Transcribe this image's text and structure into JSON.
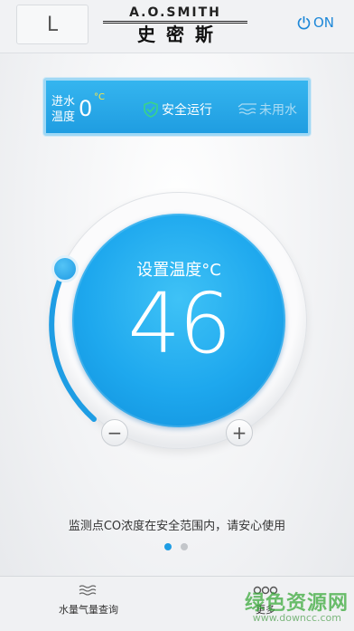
{
  "header": {
    "mode_label": "L",
    "brand_en": "A.O.SMITH",
    "brand_zh": "史密斯",
    "power_label": "ON"
  },
  "status": {
    "inlet_label": "进水\n温度",
    "inlet_line1": "进水",
    "inlet_line2": "温度",
    "inlet_value": "0",
    "inlet_unit": "°C",
    "safe_label": "安全运行",
    "water_label": "未用水"
  },
  "dial": {
    "set_label": "设置温度°C",
    "set_value": "46",
    "minus_label": "−",
    "plus_label": "+"
  },
  "notice": "监测点CO浓度在安全范围内，请安心使用",
  "pager": {
    "count": 2,
    "active": 1
  },
  "bottom": {
    "left_label": "水量气量查询",
    "right_label": "更多"
  },
  "watermark": {
    "text": "绿色资源网",
    "url": "www.downcc.com"
  },
  "colors": {
    "accent": "#1e9de4",
    "safe_icon": "#39d38a"
  }
}
